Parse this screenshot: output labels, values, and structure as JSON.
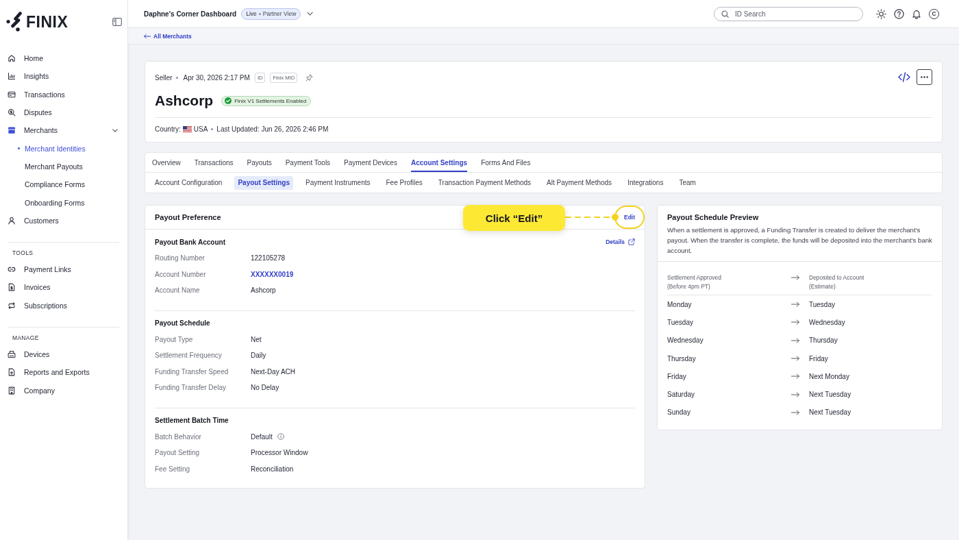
{
  "sidebar": {
    "logo": "FINIX",
    "sections": [
      {
        "items": [
          {
            "label": "Home",
            "selected": false
          },
          {
            "label": "Insights",
            "selected": false
          },
          {
            "label": "Transactions",
            "selected": false
          },
          {
            "label": "Disputes",
            "selected": false
          },
          {
            "label": "Merchants",
            "selected": true,
            "expanded": true,
            "children": [
              {
                "label": "Merchant Identities",
                "selected": true
              },
              {
                "label": "Merchant Payouts",
                "selected": false
              },
              {
                "label": "Compliance Forms",
                "selected": false
              },
              {
                "label": "Onboarding Forms",
                "selected": false
              }
            ]
          },
          {
            "label": "Customers",
            "selected": false
          }
        ]
      },
      {
        "heading": "TOOLS",
        "items": [
          {
            "label": "Payment Links",
            "selected": false
          },
          {
            "label": "Invoices",
            "selected": false
          },
          {
            "label": "Subscriptions",
            "selected": false
          }
        ]
      },
      {
        "heading": "MANAGE",
        "items": [
          {
            "label": "Devices",
            "selected": false
          },
          {
            "label": "Reports and Exports",
            "selected": false
          },
          {
            "label": "Company",
            "selected": false
          }
        ]
      }
    ]
  },
  "header": {
    "title": "Daphne's Corner Dashboard",
    "environment": {
      "mode": "Live",
      "view": "Partner View"
    },
    "search_placeholder": "ID Search",
    "user_initial": "C"
  },
  "breadcrumb": {
    "label": "All Merchants"
  },
  "merchant": {
    "type": "Seller",
    "created": "Apr 30, 2026 2:17 PM",
    "tags": [
      "ID",
      "Finix MID"
    ],
    "name": "Ashcorp",
    "status": "Finix V1 Settlements Enabled",
    "country_label": "Country:",
    "country": "USA",
    "updated": "Last Updated: Jun 26, 2026 2:46 PM"
  },
  "tabs": [
    {
      "label": "Overview",
      "selected": false
    },
    {
      "label": "Transactions",
      "selected": false
    },
    {
      "label": "Payouts",
      "selected": false
    },
    {
      "label": "Payment Tools",
      "selected": false
    },
    {
      "label": "Payment Devices",
      "selected": false
    },
    {
      "label": "Account Settings",
      "selected": true
    },
    {
      "label": "Forms And Files",
      "selected": false
    }
  ],
  "subtabs": [
    {
      "label": "Account Configuration",
      "selected": false
    },
    {
      "label": "Payout Settings",
      "selected": true
    },
    {
      "label": "Payment Instruments",
      "selected": false
    },
    {
      "label": "Fee Profiles",
      "selected": false
    },
    {
      "label": "Transaction Payment Methods",
      "selected": false
    },
    {
      "label": "Alt Payment Methods",
      "selected": false
    },
    {
      "label": "Integrations",
      "selected": false
    },
    {
      "label": "Team",
      "selected": false
    }
  ],
  "payout_preference": {
    "title": "Payout Preference",
    "edit": "Edit",
    "callout": "Click “Edit”",
    "sections": [
      {
        "title": "Payout Bank Account",
        "link": "Details",
        "rows": [
          {
            "kind": "text",
            "label": "Routing Number",
            "value": "122105278"
          },
          {
            "kind": "link",
            "label": "Account Number",
            "value": "XXXXXX0019"
          },
          {
            "kind": "text",
            "label": "Account Name",
            "value": "Ashcorp"
          }
        ]
      },
      {
        "title": "Payout Schedule",
        "rows": [
          {
            "kind": "text",
            "label": "Payout Type",
            "value": "Net"
          },
          {
            "kind": "text",
            "label": "Settlement Frequency",
            "value": "Daily"
          },
          {
            "kind": "text",
            "label": "Funding Transfer Speed",
            "value": "Next-Day ACH"
          },
          {
            "kind": "text",
            "label": "Funding Transfer Delay",
            "value": "No Delay"
          }
        ]
      },
      {
        "title": "Settlement Batch Time",
        "rows": [
          {
            "kind": "info",
            "label": "Batch Behavior",
            "value": "Default"
          },
          {
            "kind": "text",
            "label": "Payout Setting",
            "value": "Processor Window"
          },
          {
            "kind": "text",
            "label": "Fee Setting",
            "value": "Reconciliation"
          }
        ]
      }
    ]
  },
  "schedule_preview": {
    "title": "Payout Schedule Preview",
    "description": "When a settlement is approved, a Funding Transfer is created to deliver the merchant's payout. When the transfer is complete, the funds will be deposited into the merchant's bank account.",
    "columns": [
      {
        "label": "Settlement Approved",
        "note": "(Before 4pm PT)"
      },
      {
        "label": "Deposited to Account",
        "note": "(Estimate)"
      }
    ],
    "rows": [
      {
        "approved": "Monday",
        "deposited": "Tuesday"
      },
      {
        "approved": "Tuesday",
        "deposited": "Wednesday"
      },
      {
        "approved": "Wednesday",
        "deposited": "Thursday"
      },
      {
        "approved": "Thursday",
        "deposited": "Friday"
      },
      {
        "approved": "Friday",
        "deposited": "Next Monday"
      },
      {
        "approved": "Saturday",
        "deposited": "Next Tuesday"
      },
      {
        "approved": "Sunday",
        "deposited": "Next Tuesday"
      }
    ]
  }
}
